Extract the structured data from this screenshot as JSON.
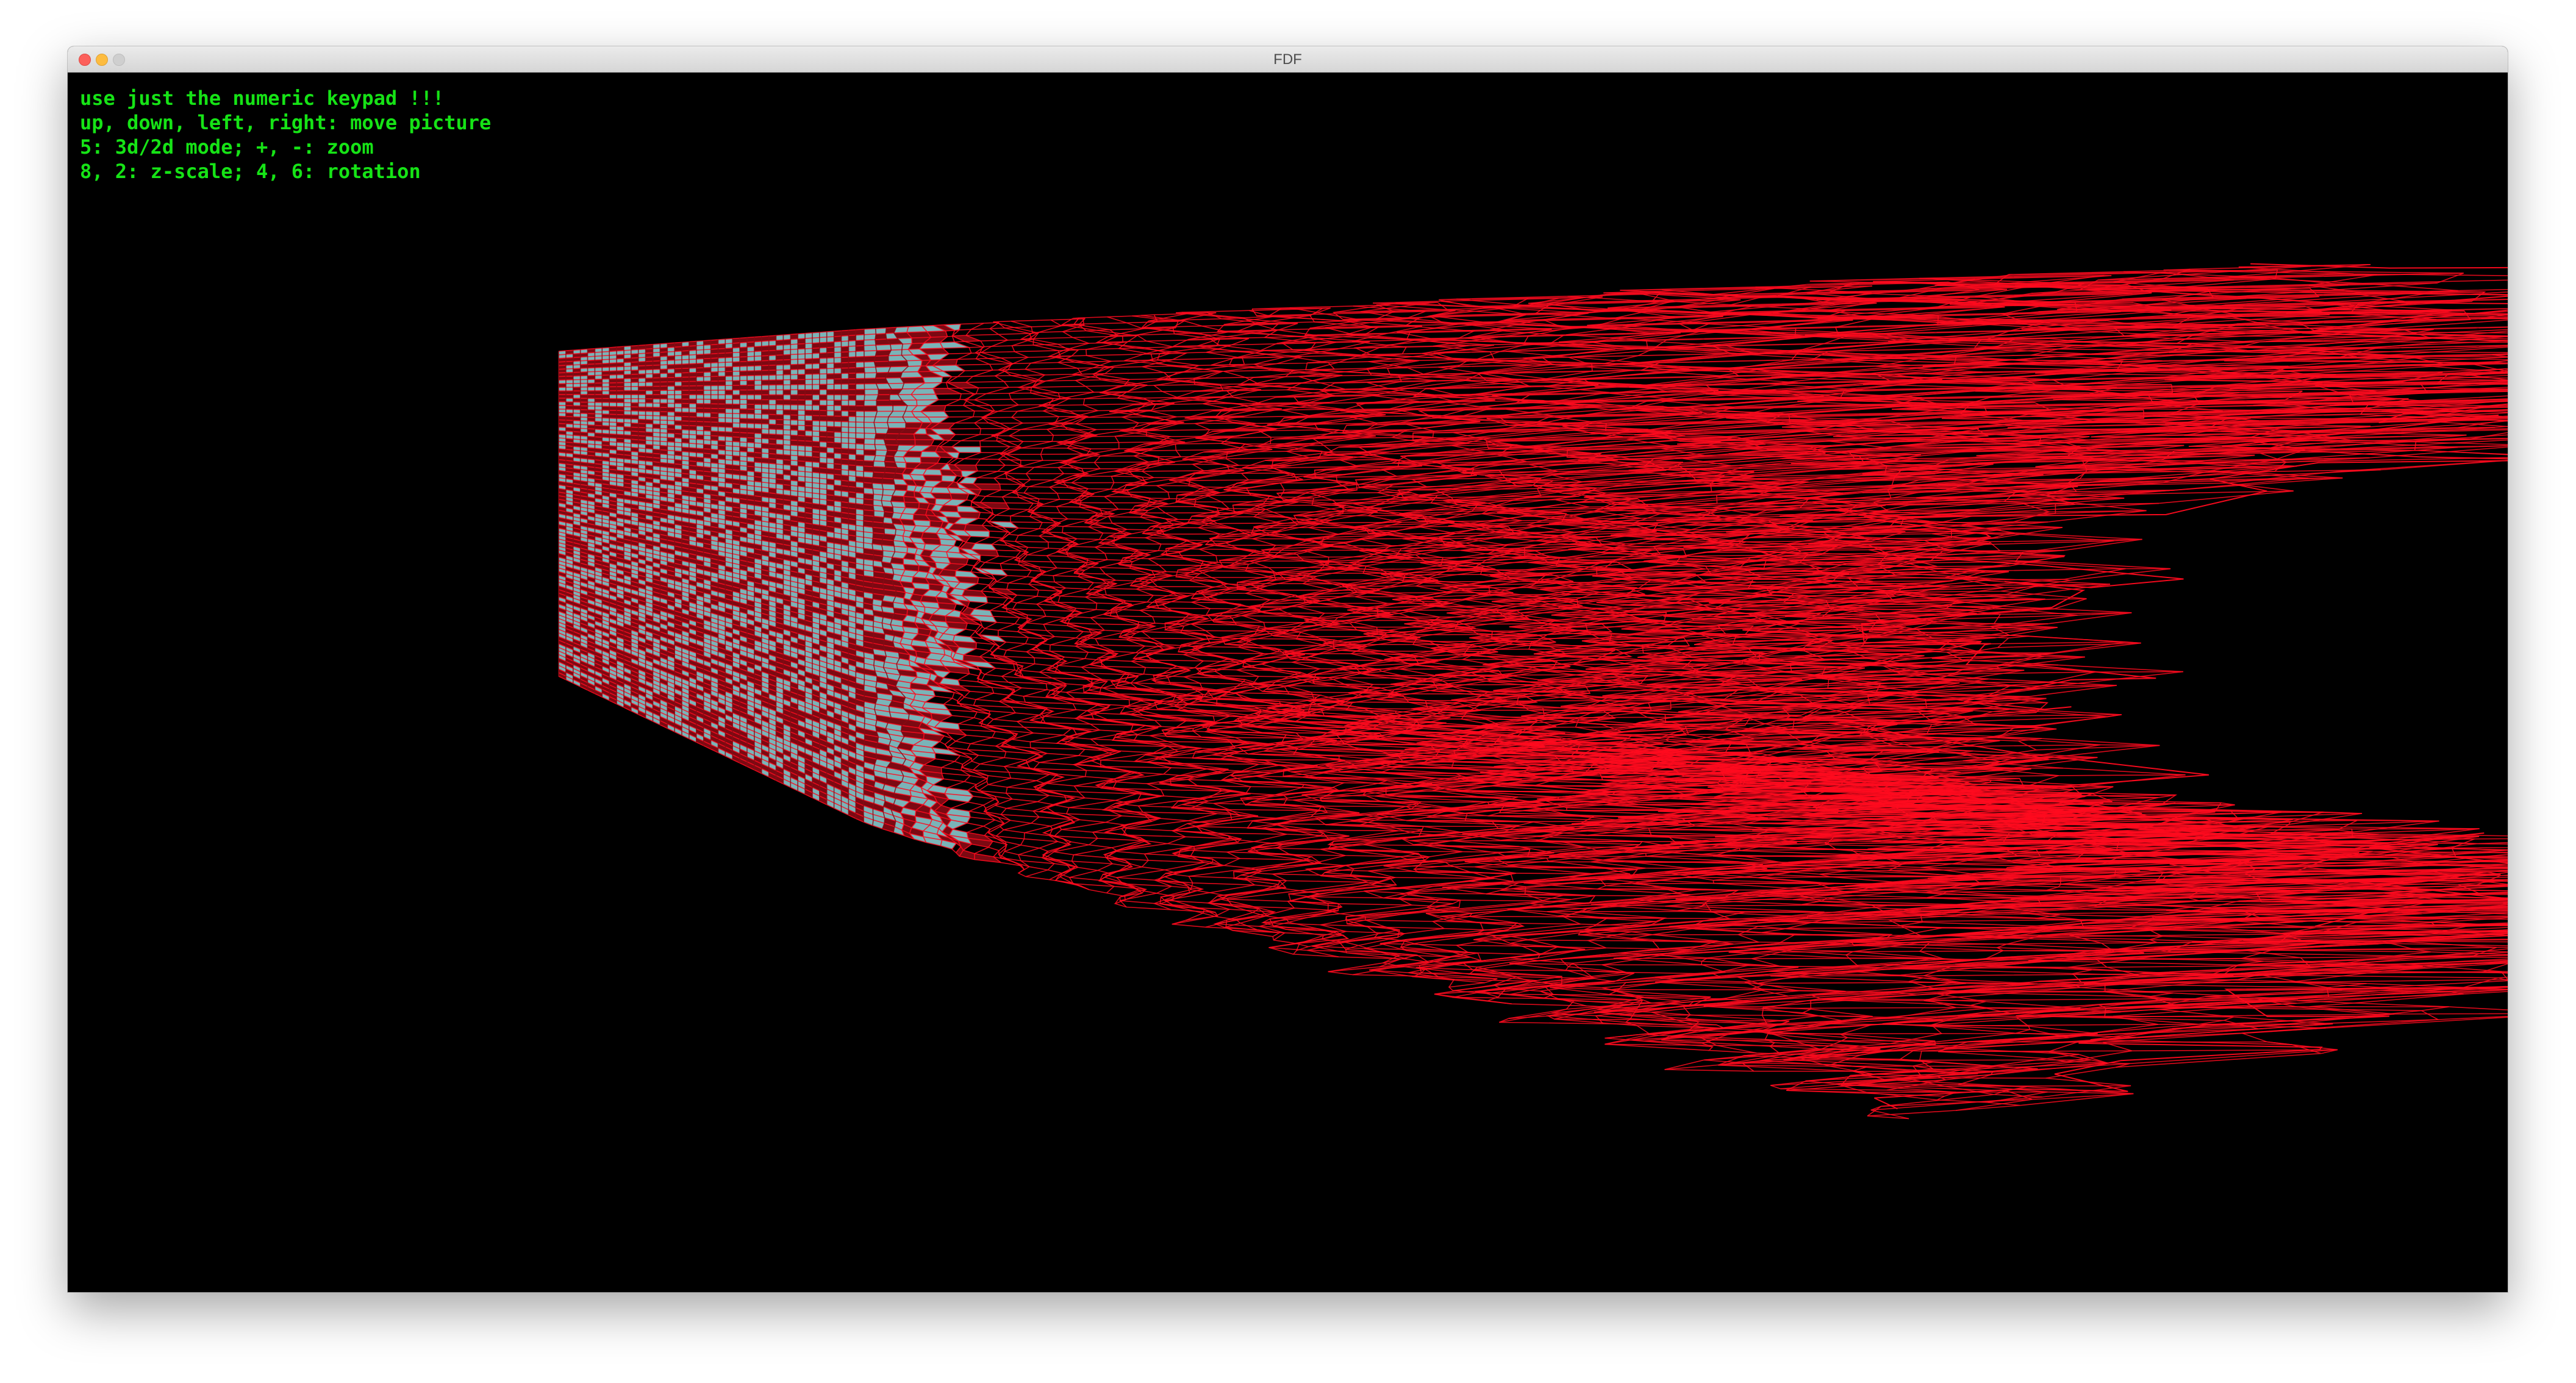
{
  "window": {
    "title": "FDF",
    "controls": {
      "close": "close-icon",
      "minimize": "minimize-icon",
      "zoom": "zoom-icon"
    }
  },
  "help_text": [
    "use just the numeric keypad !!!",
    "up, down, left, right: move picture",
    "5: 3d/2d mode; +, -: zoom",
    "8, 2: z-scale; 4, 6: rotation"
  ],
  "colors": {
    "background": "#000000",
    "help_text": "#16e316",
    "wire_high": "#ff0a1e",
    "wire_low": "#8a0a14",
    "wire_flat": "#8fd3d8"
  }
}
